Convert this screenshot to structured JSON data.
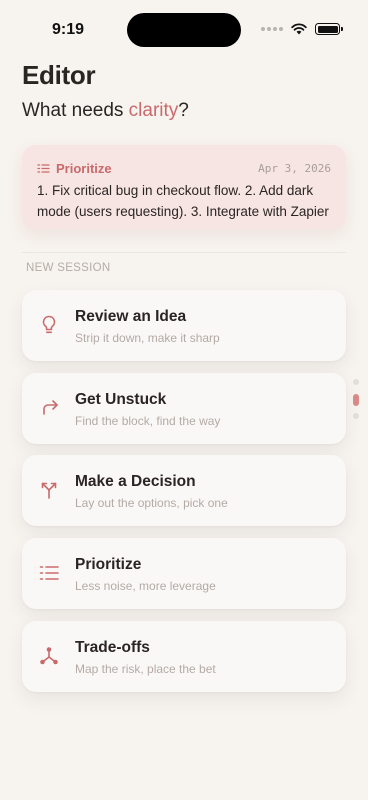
{
  "status_bar": {
    "time": "9:19"
  },
  "header": {
    "title": "Editor",
    "subtitle_prefix": "What needs ",
    "subtitle_accent": "clarity",
    "subtitle_suffix": "?"
  },
  "recent": {
    "label": "Prioritize",
    "date": "Apr 3, 2026",
    "text": "1. Fix critical bug in checkout flow. 2. Add dark mode (users requesting). 3. Integrate with Zapier"
  },
  "new_session": {
    "label": "NEW SESSION",
    "items": [
      {
        "title": "Review an Idea",
        "subtitle": "Strip it down, make it sharp",
        "icon": "lightbulb-icon"
      },
      {
        "title": "Get Unstuck",
        "subtitle": "Find the block, find the way",
        "icon": "redirect-arrow-icon"
      },
      {
        "title": "Make a Decision",
        "subtitle": "Lay out the options, pick one",
        "icon": "fork-icon"
      },
      {
        "title": "Prioritize",
        "subtitle": "Less noise, more leverage",
        "icon": "numbered-list-icon"
      },
      {
        "title": "Trade-offs",
        "subtitle": "Map the risk, place the bet",
        "icon": "network-nodes-icon"
      }
    ]
  },
  "colors": {
    "accent": "#c96a6c",
    "background": "#f7f3ef",
    "recent_card": "#f7e5e3",
    "card": "#faf8f6"
  },
  "pager": {
    "count": 3,
    "active_index": 1
  }
}
